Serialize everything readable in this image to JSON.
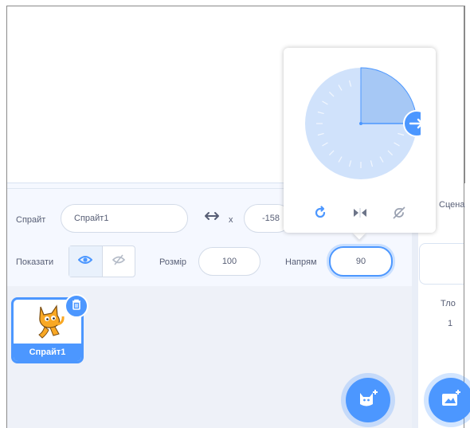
{
  "sprite_info": {
    "sprite_label": "Спрайт",
    "sprite_name": "Спрайт1",
    "x_label": "x",
    "x_value": "-158",
    "show_label": "Показати",
    "size_label": "Розмір",
    "size_value": "100",
    "direction_label": "Напрям",
    "direction_value": "90"
  },
  "sprite_list": {
    "items": [
      {
        "name": "Спрайт1"
      }
    ]
  },
  "stage_panel": {
    "title": "Сцена",
    "backdrops_label": "Тло",
    "backdrops_count": "1"
  },
  "direction_popover": {
    "direction_degrees": 90,
    "rotation_modes": [
      "all-around",
      "left-right",
      "dont-rotate"
    ],
    "selected_mode": "all-around"
  },
  "colors": {
    "accent": "#4c97ff",
    "dial_fill": "#d0e2fb",
    "dial_sector": "#a6c8f5",
    "text": "#575e75"
  }
}
